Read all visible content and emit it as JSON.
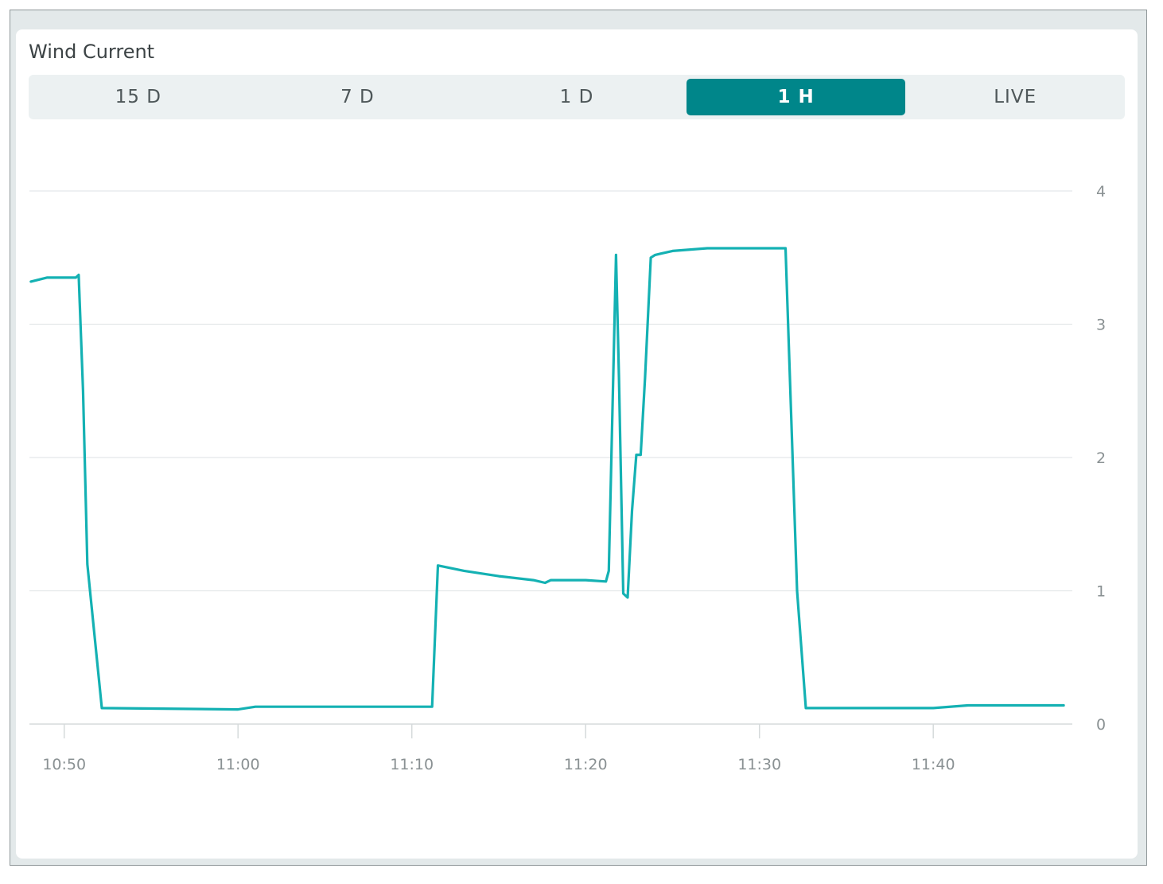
{
  "widget": {
    "title": "Wind Current",
    "tabs": [
      {
        "label": "15 D",
        "active": false
      },
      {
        "label": "7 D",
        "active": false
      },
      {
        "label": "1 D",
        "active": false
      },
      {
        "label": "1 H",
        "active": true
      },
      {
        "label": "LIVE",
        "active": false
      }
    ]
  },
  "colors": {
    "accent": "#00868a",
    "series": "#14b1b3",
    "grid": "#e4e8e9",
    "tick": "#8a9193"
  },
  "chart_data": {
    "type": "line",
    "title": "",
    "xlabel": "",
    "ylabel": "",
    "xlim": [
      "10:48",
      "11:48"
    ],
    "ylim": [
      0,
      4
    ],
    "grid": true,
    "legend": "none",
    "x_ticks": [
      "10:50",
      "11:00",
      "11:10",
      "11:20",
      "11:30",
      "11:40"
    ],
    "y_ticks": [
      0,
      1,
      2,
      3,
      4
    ],
    "series": [
      {
        "name": "",
        "x": [
          "10:48:05",
          "10:49:00",
          "10:50:00",
          "10:50:40",
          "10:50:50",
          "10:51:05",
          "10:51:20",
          "10:52:10",
          "11:00:00",
          "11:01:00",
          "11:05:00",
          "11:10:00",
          "11:11:10",
          "11:11:30",
          "11:13:00",
          "11:15:00",
          "11:17:00",
          "11:17:40",
          "11:18:00",
          "11:20:00",
          "11:21:10",
          "11:21:20",
          "11:21:45",
          "11:21:55",
          "11:22:10",
          "11:22:25",
          "11:22:40",
          "11:22:55",
          "11:23:10",
          "11:23:25",
          "11:23:45",
          "11:24:00",
          "11:24:20",
          "11:25:00",
          "11:27:00",
          "11:29:00",
          "11:31:30",
          "11:32:10",
          "11:32:40",
          "11:33:00",
          "11:36:00",
          "11:40:00",
          "11:42:00",
          "11:47:30"
        ],
        "y": [
          3.32,
          3.35,
          3.35,
          3.35,
          3.37,
          2.5,
          1.2,
          0.12,
          0.11,
          0.13,
          0.13,
          0.13,
          0.13,
          1.19,
          1.15,
          1.11,
          1.08,
          1.06,
          1.08,
          1.08,
          1.07,
          1.15,
          3.52,
          2.6,
          0.98,
          0.95,
          1.6,
          2.02,
          2.02,
          2.6,
          3.5,
          3.52,
          3.53,
          3.55,
          3.57,
          3.57,
          3.57,
          1.0,
          0.12,
          0.12,
          0.12,
          0.12,
          0.14,
          0.14
        ]
      }
    ]
  }
}
